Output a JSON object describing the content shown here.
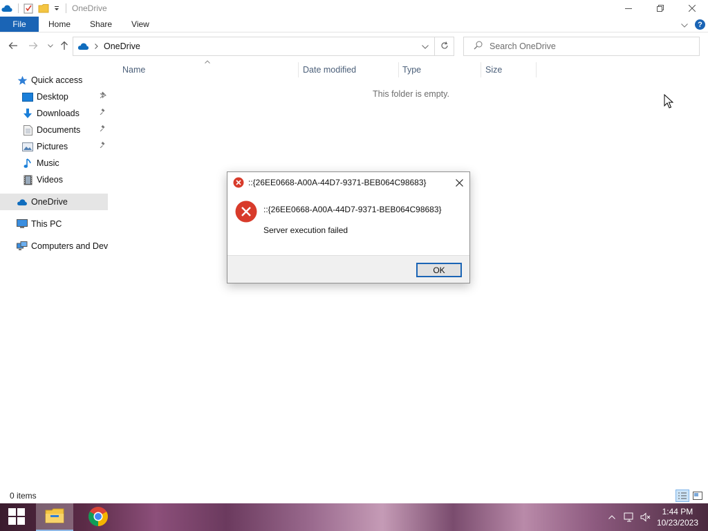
{
  "window": {
    "title": "OneDrive",
    "controls": {
      "minimize": "minimize",
      "maximize": "restore",
      "close": "close"
    }
  },
  "ribbon": {
    "tabs": [
      "File",
      "Home",
      "Share",
      "View"
    ]
  },
  "address": {
    "location": "OneDrive",
    "search_placeholder": "Search OneDrive"
  },
  "sidebar": {
    "quick_access": "Quick access",
    "quick_items": [
      {
        "label": "Desktop",
        "icon": "desktop-icon",
        "pinned": true
      },
      {
        "label": "Downloads",
        "icon": "downloads-icon",
        "pinned": true
      },
      {
        "label": "Documents",
        "icon": "documents-icon",
        "pinned": true
      },
      {
        "label": "Pictures",
        "icon": "pictures-icon",
        "pinned": true
      },
      {
        "label": "Music",
        "icon": "music-icon",
        "pinned": false
      },
      {
        "label": "Videos",
        "icon": "videos-icon",
        "pinned": false
      }
    ],
    "onedrive": "OneDrive",
    "this_pc": "This PC",
    "computers": "Computers and Devic"
  },
  "content": {
    "columns": [
      "Name",
      "Date modified",
      "Type",
      "Size"
    ],
    "empty_message": "This folder is empty."
  },
  "status": {
    "item_count": "0 items"
  },
  "dialog": {
    "title": "::{26EE0668-A00A-44D7-9371-BEB064C98683}",
    "message_line1": "::{26EE0668-A00A-44D7-9371-BEB064C98683}",
    "message_line2": "Server execution failed",
    "ok_label": "OK"
  },
  "taskbar": {
    "time": "1:44 PM",
    "date": "10/23/2023"
  },
  "colors": {
    "accent": "#1a64b5",
    "error_red": "#d83b2b",
    "onedrive_blue": "#0f6cbd",
    "folder_yellow": "#f4c542"
  }
}
